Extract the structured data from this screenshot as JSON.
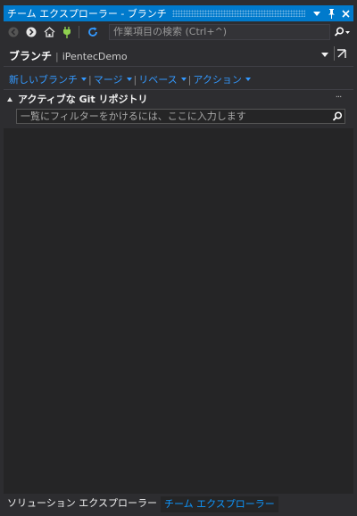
{
  "window": {
    "title": "チーム エクスプローラー - ブランチ",
    "colors": {
      "accent": "#007acc",
      "link": "#3399ff",
      "background": "#252526",
      "chrome": "#2d2d30"
    }
  },
  "toolbar": {
    "icons": [
      "back-icon",
      "forward-icon",
      "home-icon",
      "connect-icon",
      "refresh-icon"
    ],
    "search_placeholder": "作業項目の検索 (Ctrl+^)"
  },
  "header": {
    "title": "ブランチ",
    "separator": "|",
    "repo": "iPentecDemo"
  },
  "actions": [
    {
      "label": "新しいブランチ"
    },
    {
      "label": "マージ"
    },
    {
      "label": "リベース"
    },
    {
      "label": "アクション"
    }
  ],
  "section": {
    "label": "アクティブな Git リポジトリ",
    "more": "···",
    "filter_placeholder": "一覧にフィルターをかけるには、ここに入力します"
  },
  "tabs": [
    {
      "label": "ソリューション エクスプローラー",
      "active": false
    },
    {
      "label": "チーム エクスプローラー",
      "active": true
    }
  ]
}
